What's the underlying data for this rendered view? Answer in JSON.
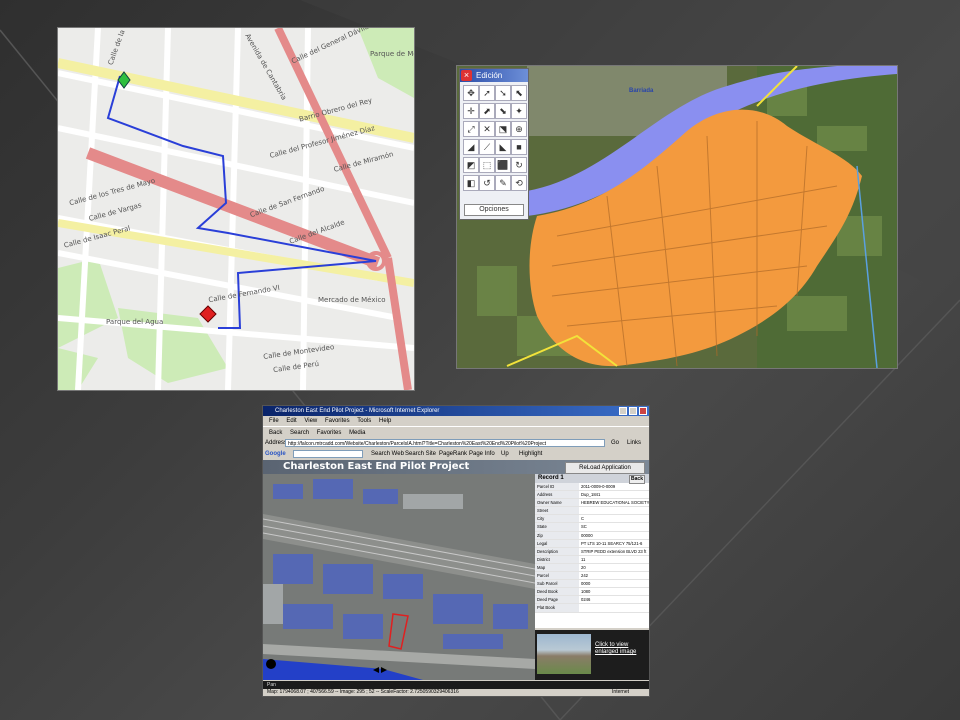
{
  "colors": {
    "background": "#3a3a3a",
    "orange_zone": "#f39a3e",
    "river": "#8a8ff0",
    "route": "#2a3fd8",
    "major_road": "#e48a8a"
  },
  "map1": {
    "street_labels": [
      "Calle de la Tala",
      "Parque de Mendizozque",
      "Calle del General Dávila",
      "Avenida de Cantabria",
      "Barrio Obrero del Rey",
      "Calle del Profesor Jiménez Díaz",
      "Calle de Miramón",
      "Calle de los Tres de Mayo",
      "Calle de Vargas",
      "Calle de Isaac Peral",
      "Calle de San Fernando",
      "Calle del Alcalde",
      "Calle de Fernando VI",
      "Mercado de México",
      "Parque del Agua",
      "Calle de Montevideo",
      "Calle de Perú"
    ],
    "start_marker_icon": "green-diamond-marker",
    "end_marker_icon": "red-diamond-marker"
  },
  "map2": {
    "toolbar_title": "Edición",
    "close_glyph": "×",
    "tools": [
      "✥",
      "➚",
      "➘",
      "⬉",
      "✛",
      "⬈",
      "⬊",
      "✦",
      "⤢",
      "✕",
      "⬔",
      "⊕",
      "◢",
      "⟋",
      "◣",
      "■",
      "◩",
      "⬚",
      "⬛",
      "↻",
      "◧",
      "↺",
      "✎",
      "⟲"
    ],
    "options_button": "Opciones",
    "river_label": "Barriada"
  },
  "browser": {
    "window_title": "Charleston East End Pilot Project - Microsoft Internet Explorer",
    "menu": [
      "File",
      "Edit",
      "View",
      "Favorites",
      "Tools",
      "Help"
    ],
    "toolbar": [
      "Back",
      "Search",
      "Favorites",
      "Media"
    ],
    "address_label": "Address",
    "address_value": "http://falcon.mtrcadd.com/Website/Charleston/ParcelsIA.html?Title=Charleston%20East%20End%20Pilot%20Project",
    "go_label": "Go",
    "links_label": "Links",
    "google_label": "Google",
    "google_buttons": [
      "Search Web",
      "Search Site",
      "PageRank",
      "Page Info",
      "Up",
      "Highlight"
    ],
    "app_title": "Charleston East End Pilot Project",
    "reload_button": "ReLoad Application",
    "record_title": "Record 1",
    "back_button": "Back",
    "record_rows": [
      {
        "k": "Parcel ID",
        "v": "2011-0009-0-0009"
      },
      {
        "k": "Address",
        "v": "Dup_1841"
      },
      {
        "k": "Owner Name",
        "v": "HEBREW EDUCATIONAL SOCIETY"
      },
      {
        "k": "Street",
        "v": ""
      },
      {
        "k": "City",
        "v": "C"
      },
      {
        "k": "State",
        "v": "SC"
      },
      {
        "k": "Zip",
        "v": "00000"
      },
      {
        "k": "Legal",
        "v": "PT LTS 10-11 SEARCY 75/121-6"
      },
      {
        "k": "Description",
        "v": "STRIP PEDD extension BLVD 23 ft"
      },
      {
        "k": "District",
        "v": "11"
      },
      {
        "k": "Map",
        "v": "20"
      },
      {
        "k": "Parcel",
        "v": "242"
      },
      {
        "k": "Sub Parcel",
        "v": "0000"
      },
      {
        "k": "Deed Book",
        "v": "1080"
      },
      {
        "k": "Deed Page",
        "v": "0246"
      },
      {
        "k": "Plat Book",
        "v": ""
      }
    ],
    "thumbnail_link": "Click to view enlarged image",
    "status_text": "Map: 1794068.07 ; 407566.59 -- Image: 295 ; 52 -- ScaleFactor: 2.7250590329406316",
    "status_zone": "Internet",
    "pan_label": "Pan"
  }
}
